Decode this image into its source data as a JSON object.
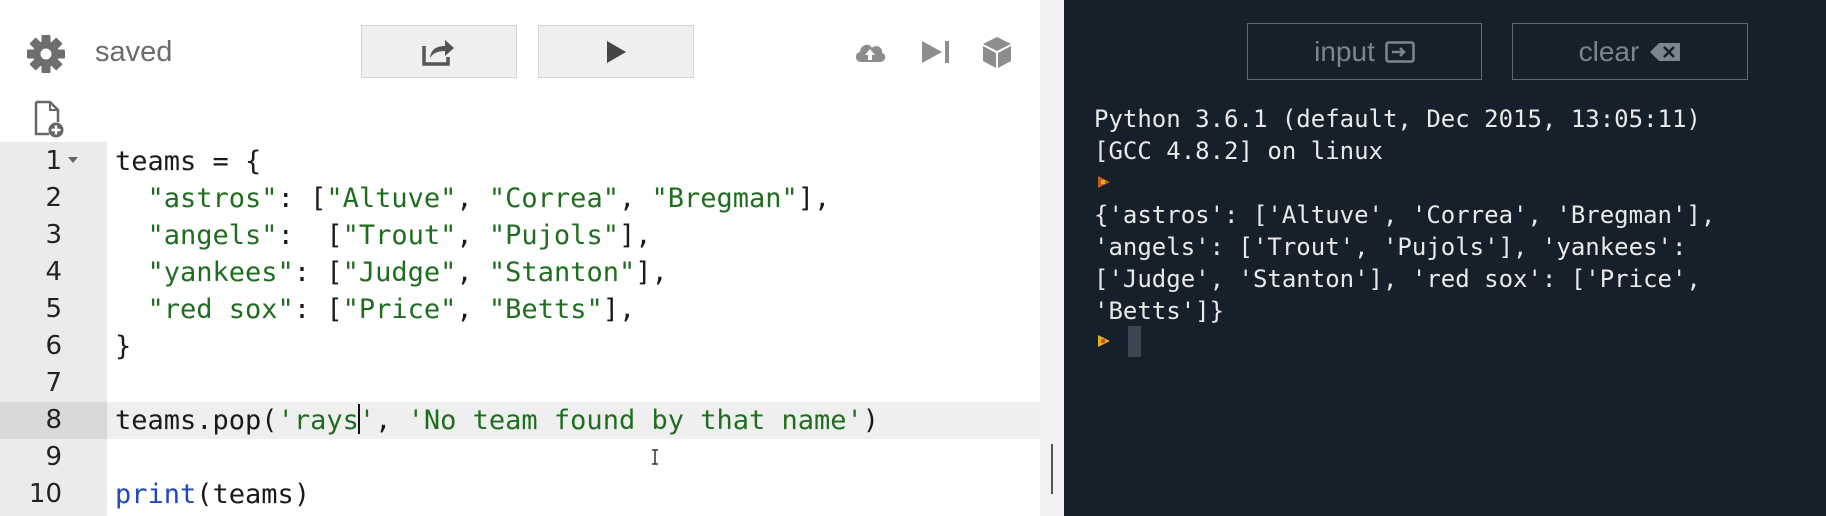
{
  "toolbar": {
    "status": "saved"
  },
  "editor": {
    "line_numbers": [
      "1",
      "2",
      "3",
      "4",
      "5",
      "6",
      "7",
      "8",
      "9",
      "10"
    ],
    "active_line": 8
  },
  "console": {
    "input_label": "input",
    "clear_label": "clear",
    "banner_1": "Python 3.6.1 (default, Dec 2015, 13:05:11)",
    "banner_2": "[GCC 4.8.2] on linux",
    "output": [
      "{'astros': ['Altuve', 'Correa', 'Bregman'],",
      "'angels': ['Trout', 'Pujols'], 'yankees':",
      "['Judge', 'Stanton'], 'red sox': ['Price',",
      "'Betts']}"
    ]
  },
  "colors": {
    "console_bg": "#15202b",
    "string_green": "#1f6e1f",
    "builtin_blue": "#2249b8",
    "prompt_orange": "#c8581f",
    "prompt_yellow": "#e0b020"
  },
  "icons": [
    "gear-icon",
    "share-icon",
    "play-icon",
    "cloud-upload-icon",
    "step-icon",
    "package-icon",
    "new-file-icon",
    "input-icon",
    "clear-icon",
    "prompt-icon"
  ]
}
